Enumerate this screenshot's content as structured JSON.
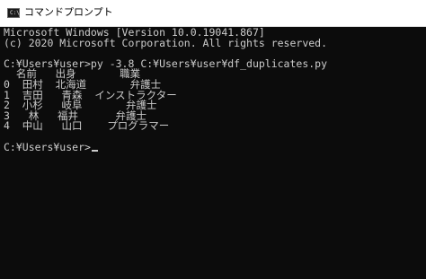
{
  "window": {
    "title": "コマンドプロンプト",
    "icon": "console-app-icon",
    "icon_glyph": "C:\\"
  },
  "console": {
    "lines": [
      "Microsoft Windows [Version 10.0.19041.867]",
      "(c) 2020 Microsoft Corporation. All rights reserved.",
      "",
      "C:¥Users¥user>py -3.8 C:¥Users¥user¥df_duplicates.py",
      "  名前   出身       職業",
      "0  田村  北海道       弁護士",
      "1  吉田   青森  インストラクター",
      "2  小杉   岐阜       弁護士",
      "3   林   福井      弁護士",
      "4  中山   山口    プログラマー",
      "",
      "C:¥Users¥user>"
    ]
  },
  "colors": {
    "console_bg": "#0c0c0c",
    "console_fg": "#cccccc",
    "titlebar_bg": "#ffffff"
  }
}
